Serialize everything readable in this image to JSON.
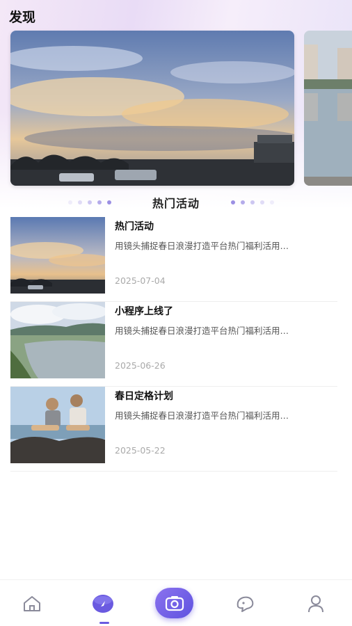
{
  "page": {
    "title": "发现"
  },
  "section": {
    "title": "热门活动"
  },
  "news": [
    {
      "title": "热门活动",
      "desc": "用镜头捕捉春日浪漫打造平台热门福利活用…",
      "date": "2025-07-04"
    },
    {
      "title": "小程序上线了",
      "desc": "用镜头捕捉春日浪漫打造平台热门福利活用…",
      "date": "2025-06-26"
    },
    {
      "title": "春日定格计划",
      "desc": "用镜头捕捉春日浪漫打造平台热门福利活用…",
      "date": "2025-05-22"
    }
  ],
  "tabbar": {
    "items": [
      {
        "icon": "home-icon",
        "active": false
      },
      {
        "icon": "discover-icon",
        "active": true
      },
      {
        "icon": "camera-icon",
        "active": false
      },
      {
        "icon": "chat-icon",
        "active": false
      },
      {
        "icon": "profile-icon",
        "active": false
      }
    ]
  },
  "colors": {
    "accent": "#6a5ae0",
    "inactive_icon": "#8a8a9a",
    "date": "#a9a9a9"
  }
}
